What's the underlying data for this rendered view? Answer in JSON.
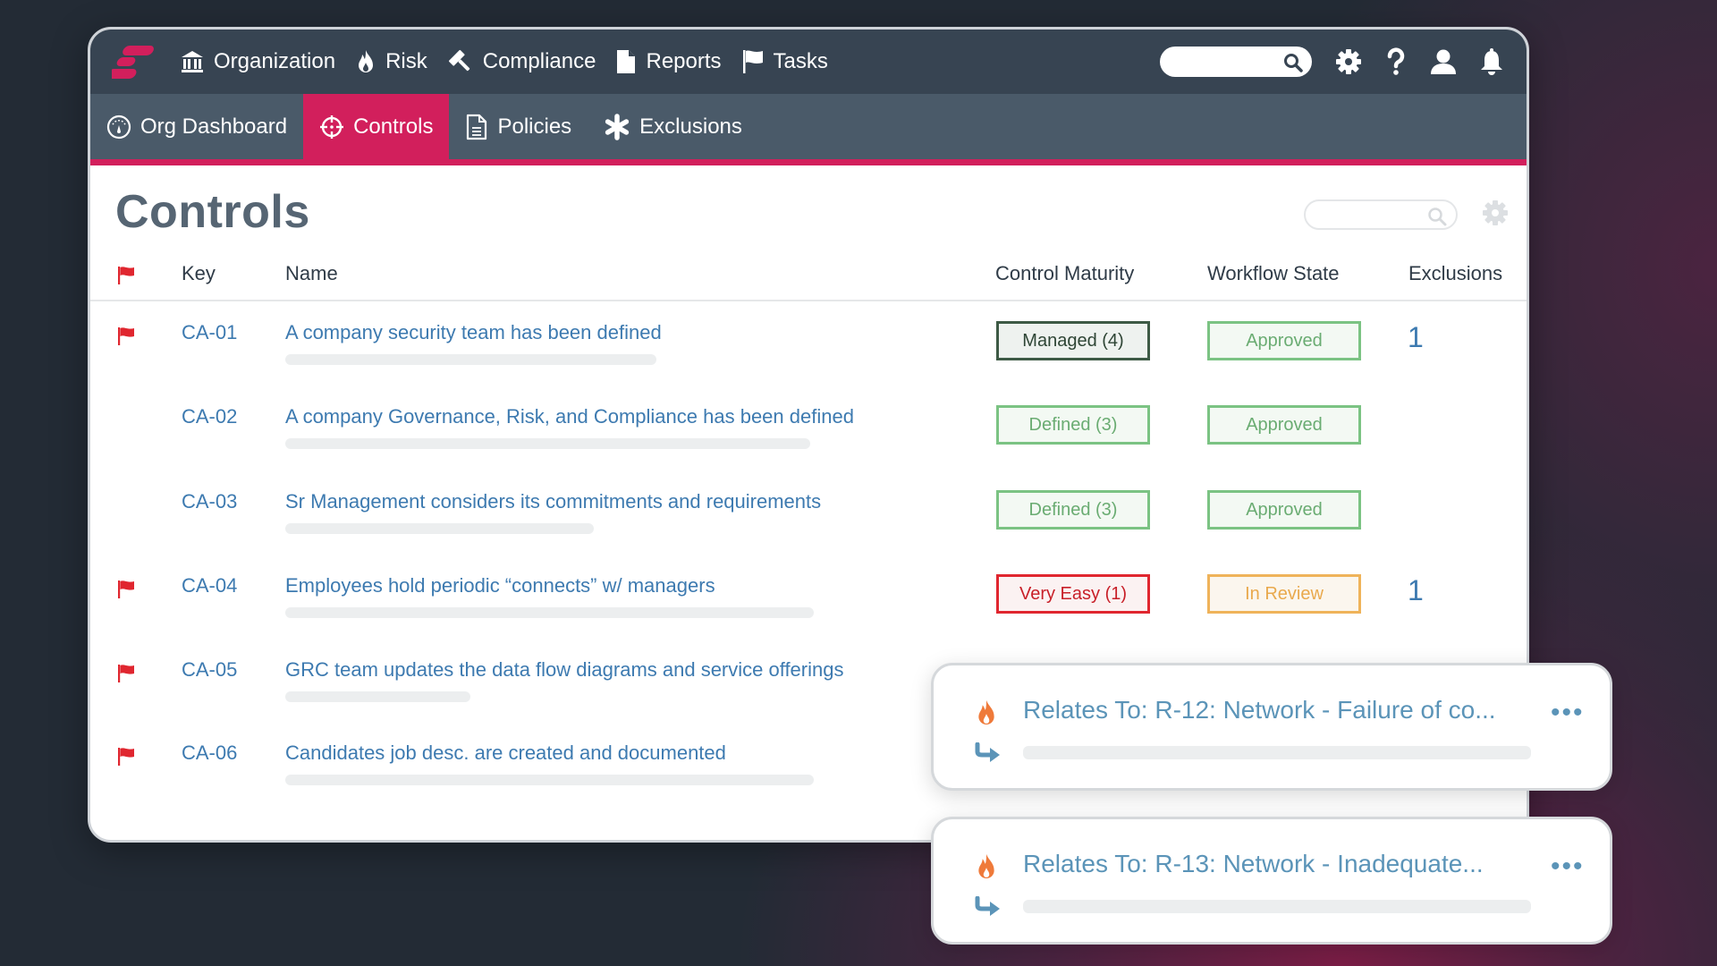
{
  "colors": {
    "brand": "#d21f5c",
    "topnav_bg": "#374452",
    "subnav_bg": "#4a5a69",
    "link": "#3d7ab0",
    "flag": "#e0262f",
    "risk_fire": "#ef7a3a"
  },
  "topnav": {
    "items": [
      {
        "label": "Organization",
        "icon": "bank-icon"
      },
      {
        "label": "Risk",
        "icon": "fire-icon"
      },
      {
        "label": "Compliance",
        "icon": "gavel-icon"
      },
      {
        "label": "Reports",
        "icon": "file-icon"
      },
      {
        "label": "Tasks",
        "icon": "flag-icon"
      }
    ],
    "search_placeholder": "",
    "tools": [
      "gear-icon",
      "help-icon",
      "user-icon",
      "bell-icon"
    ]
  },
  "subnav": {
    "items": [
      {
        "label": "Org Dashboard",
        "icon": "dashboard-icon",
        "active": false
      },
      {
        "label": "Controls",
        "icon": "crosshair-icon",
        "active": true
      },
      {
        "label": "Policies",
        "icon": "document-icon",
        "active": false
      },
      {
        "label": "Exclusions",
        "icon": "asterisk-icon",
        "active": false
      }
    ]
  },
  "page": {
    "title": "Controls",
    "search_placeholder": ""
  },
  "table": {
    "columns": [
      "Key",
      "Name",
      "Control Maturity",
      "Workflow State",
      "Exclusions"
    ],
    "rows": [
      {
        "flagged": true,
        "key": "CA-01",
        "name": "A company security team has been defined",
        "maturity": "Managed (4)",
        "maturity_level": "managed",
        "workflow": "Approved",
        "workflow_state": "approved",
        "exclusions": "1"
      },
      {
        "flagged": false,
        "key": "CA-02",
        "name": "A company Governance, Risk, and Compliance has been defined",
        "maturity": "Defined (3)",
        "maturity_level": "defined",
        "workflow": "Approved",
        "workflow_state": "approved",
        "exclusions": ""
      },
      {
        "flagged": false,
        "key": "CA-03",
        "name": "Sr Management considers its commitments and requirements",
        "maturity": "Defined (3)",
        "maturity_level": "defined",
        "workflow": "Approved",
        "workflow_state": "approved",
        "exclusions": ""
      },
      {
        "flagged": true,
        "key": "CA-04",
        "name": "Employees hold periodic “connects” w/ managers",
        "maturity": "Very Easy (1)",
        "maturity_level": "very-easy",
        "workflow": "In Review",
        "workflow_state": "in-review",
        "exclusions": "1"
      },
      {
        "flagged": true,
        "key": "CA-05",
        "name": "GRC team updates the data flow diagrams and service offerings",
        "maturity": "",
        "maturity_level": "",
        "workflow": "",
        "workflow_state": "",
        "exclusions": ""
      },
      {
        "flagged": true,
        "key": "CA-06",
        "name": "Candidates job desc. are created and documented",
        "maturity": "",
        "maturity_level": "",
        "workflow": "",
        "workflow_state": "",
        "exclusions": ""
      }
    ]
  },
  "related_cards": [
    {
      "label": "Relates To: R-12: Network - Failure of co...",
      "icon": "fire-icon",
      "sub_icon": "redirect-arrow-icon",
      "more": "•••"
    },
    {
      "label": "Relates To: R-13: Network - Inadequate...",
      "icon": "fire-icon",
      "sub_icon": "redirect-arrow-icon",
      "more": "•••"
    }
  ]
}
